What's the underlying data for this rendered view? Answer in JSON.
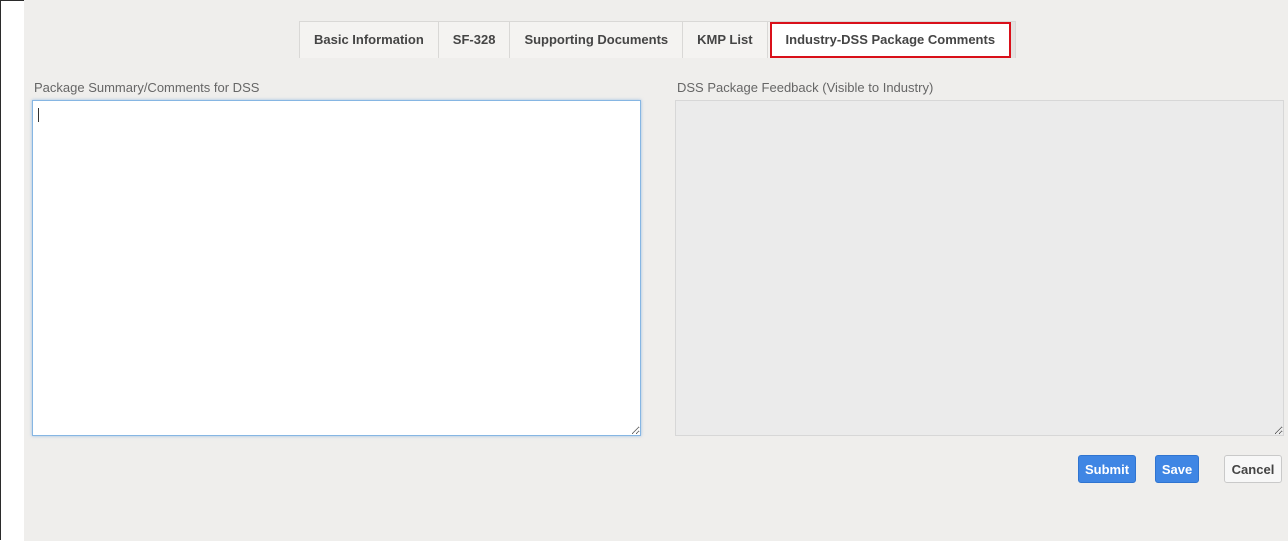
{
  "tabs": [
    {
      "label": "Basic Information",
      "active": false
    },
    {
      "label": "SF-328",
      "active": false
    },
    {
      "label": "Supporting Documents",
      "active": false
    },
    {
      "label": "KMP List",
      "active": false
    },
    {
      "label": "Industry-DSS Package Comments",
      "active": true
    }
  ],
  "left_field": {
    "label": "Package Summary/Comments for DSS",
    "value": ""
  },
  "right_field": {
    "label": "DSS Package Feedback (Visible to Industry)",
    "value": ""
  },
  "buttons": {
    "submit": "Submit",
    "save": "Save",
    "cancel": "Cancel"
  },
  "colors": {
    "accent": "#3f86e4",
    "active_tab_border": "#d9101a",
    "panel_background": "#efeeec"
  }
}
